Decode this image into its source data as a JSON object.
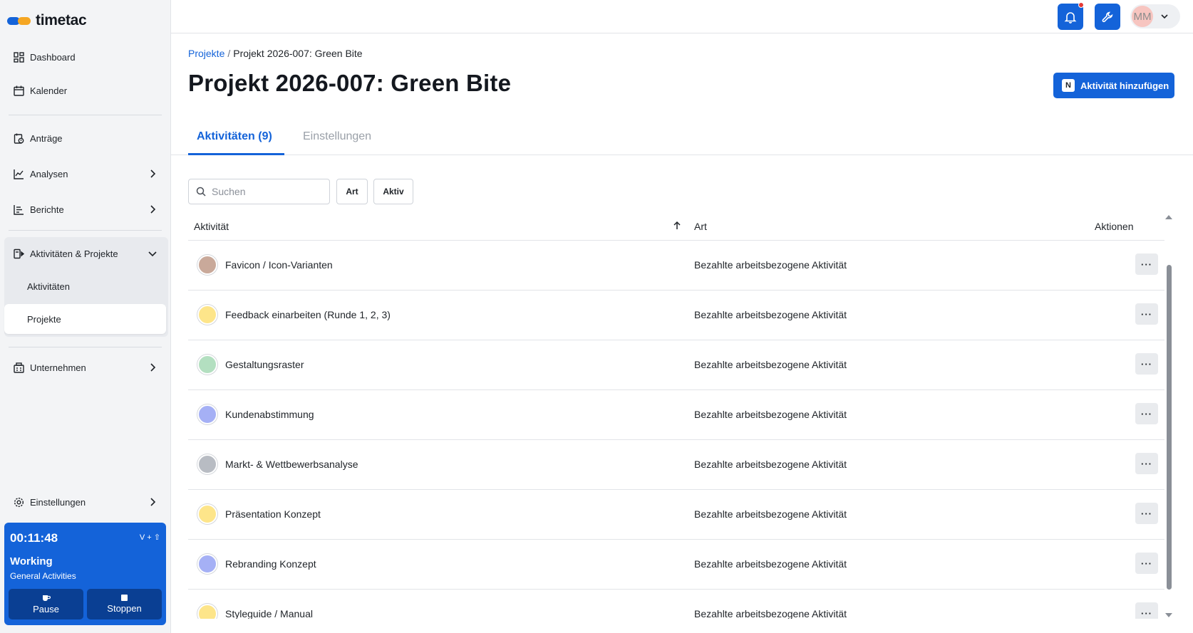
{
  "app": {
    "logo_text": "timetac",
    "brand_blue": "#1463d9",
    "brand_orange": "#f5a623"
  },
  "sidebar": {
    "items": [
      {
        "label": "Dashboard",
        "icon": "dashboard-icon"
      },
      {
        "label": "Kalender",
        "icon": "calendar-icon"
      },
      {
        "label": "Anträge",
        "icon": "requests-icon"
      },
      {
        "label": "Analysen",
        "icon": "analytics-icon"
      },
      {
        "label": "Berichte",
        "icon": "reports-icon"
      },
      {
        "label": "Aktivitäten & Projekte",
        "icon": "activities-icon"
      },
      {
        "label": "Unternehmen",
        "icon": "company-icon"
      },
      {
        "label": "Einstellungen",
        "icon": "settings-icon"
      }
    ],
    "subitems": [
      {
        "label": "Aktivitäten"
      },
      {
        "label": "Projekte",
        "active": true
      }
    ]
  },
  "timer": {
    "time": "00:11:48",
    "shortcut": "V + ⇧",
    "status": "Working",
    "sub": "General Activities",
    "pause_label": "Pause",
    "stop_label": "Stoppen"
  },
  "topbar": {
    "user_initials": "MM"
  },
  "breadcrumb": {
    "parent": "Projekte",
    "sep": "/",
    "current": "Projekt 2026-007: Green Bite"
  },
  "page": {
    "title": "Projekt 2026-007: Green Bite",
    "add_button": "Aktivität hinzufügen",
    "add_shortcut": "N"
  },
  "tabs": [
    {
      "label": "Aktivitäten (9)",
      "active": true
    },
    {
      "label": "Einstellungen",
      "active": false
    }
  ],
  "filters": {
    "search_placeholder": "Suchen",
    "type_label": "Art",
    "active_label": "Aktiv"
  },
  "table": {
    "columns": [
      "Aktivität",
      "Art",
      "Aktionen"
    ],
    "rows": [
      {
        "name": "Favicon / Icon-Varianten",
        "type": "Bezahlte arbeitsbezogene Aktivität",
        "color": "#c9a99a"
      },
      {
        "name": "Feedback einarbeiten (Runde 1, 2, 3)",
        "type": "Bezahlte arbeitsbezogene Aktivität",
        "color": "#fde58a"
      },
      {
        "name": "Gestaltungsraster",
        "type": "Bezahlte arbeitsbezogene Aktivität",
        "color": "#b3dfc0"
      },
      {
        "name": "Kundenabstimmung",
        "type": "Bezahlte arbeitsbezogene Aktivität",
        "color": "#a5b0f5"
      },
      {
        "name": "Markt- & Wettbewerbsanalyse",
        "type": "Bezahlte arbeitsbezogene Aktivität",
        "color": "#b8bcc3"
      },
      {
        "name": "Präsentation Konzept",
        "type": "Bezahlte arbeitsbezogene Aktivität",
        "color": "#fde58a"
      },
      {
        "name": "Rebranding Konzept",
        "type": "Bezahlte arbeitsbezogene Aktivität",
        "color": "#a5b0f5"
      },
      {
        "name": "Styleguide / Manual",
        "type": "Bezahlte arbeitsbezogene Aktivität",
        "color": "#fde58a"
      }
    ],
    "row_action_label": "···"
  }
}
